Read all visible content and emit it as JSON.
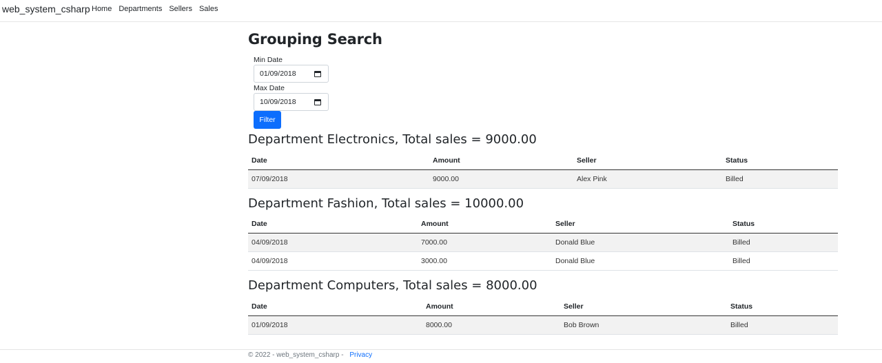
{
  "navbar": {
    "brand": "web_system_csharp",
    "links": [
      "Home",
      "Departments",
      "Sellers",
      "Sales"
    ]
  },
  "page": {
    "title": "Grouping Search",
    "min_date_label": "Min Date",
    "min_date_value": "01/09/2018",
    "max_date_label": "Max Date",
    "max_date_value": "10/09/2018",
    "filter_label": "Filter"
  },
  "table_headers": [
    "Date",
    "Amount",
    "Seller",
    "Status"
  ],
  "departments": [
    {
      "title": "Department Electronics, Total sales = 9000.00",
      "rows": [
        [
          "07/09/2018",
          "9000.00",
          "Alex Pink",
          "Billed"
        ]
      ]
    },
    {
      "title": "Department Fashion, Total sales = 10000.00",
      "rows": [
        [
          "04/09/2018",
          "7000.00",
          "Donald Blue",
          "Billed"
        ],
        [
          "04/09/2018",
          "3000.00",
          "Donald Blue",
          "Billed"
        ]
      ]
    },
    {
      "title": "Department Computers, Total sales = 8000.00",
      "rows": [
        [
          "01/09/2018",
          "8000.00",
          "Bob Brown",
          "Billed"
        ]
      ]
    }
  ],
  "footer": {
    "text": "© 2022 - web_system_csharp -",
    "privacy": "Privacy"
  },
  "colors": {
    "primary_button": "#0d6efd",
    "row_stripe": "#f2f2f2"
  }
}
